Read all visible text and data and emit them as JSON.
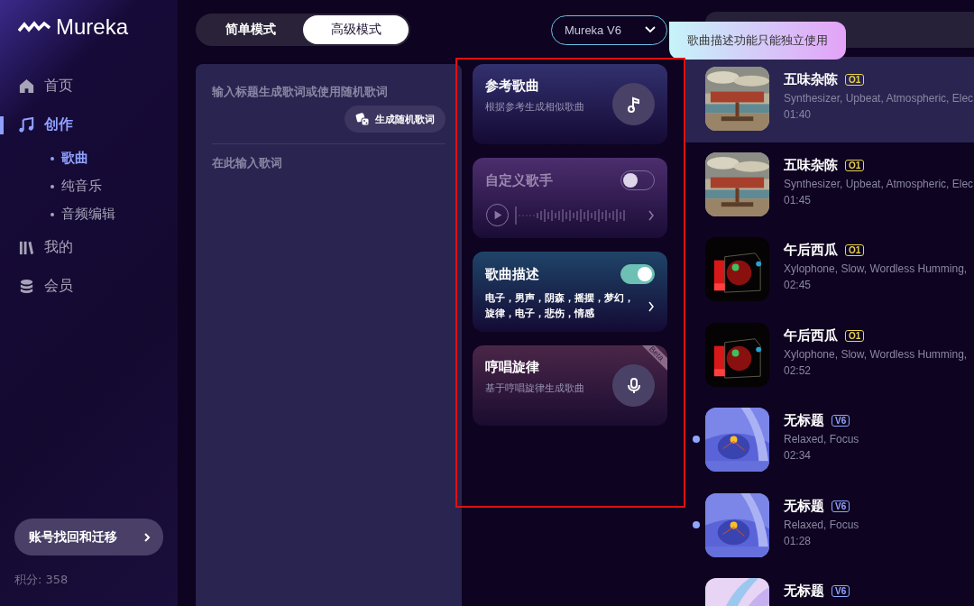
{
  "sidebar": {
    "logo": "Mureka",
    "nav": [
      {
        "kind": "home",
        "label": "首页",
        "selected": false
      },
      {
        "kind": "music",
        "label": "创作",
        "selected": true,
        "children": [
          {
            "label": "歌曲",
            "selected": true
          },
          {
            "label": "纯音乐",
            "selected": false
          },
          {
            "label": "音频编辑",
            "selected": false
          }
        ]
      },
      {
        "kind": "library",
        "label": "我的",
        "selected": false
      },
      {
        "kind": "coins",
        "label": "会员",
        "selected": false
      }
    ],
    "account_button": "账号找回和迁移",
    "points": "积分: 358"
  },
  "mode_tabs": [
    {
      "label": "简单模式",
      "selected": false
    },
    {
      "label": "高级模式",
      "selected": true
    }
  ],
  "model_select": "Mureka V6",
  "tooltip": "歌曲描述功能只能独立使用",
  "lyrics": {
    "title_placeholder": "输入标题生成歌词或使用随机歌词",
    "random_button": "生成随机歌词",
    "lyrics_placeholder": "在此输入歌词"
  },
  "cards": [
    {
      "kind": "reference",
      "title": "参考歌曲",
      "subtitle": "根据参考生成相似歌曲"
    },
    {
      "kind": "voice",
      "title": "自定义歌手",
      "on": false
    },
    {
      "kind": "description",
      "title": "歌曲描述",
      "on": true,
      "text": "电子，男声，阴森，摇摆，梦幻，旋律，电子，悲伤，情感"
    },
    {
      "kind": "humming",
      "title": "哼唱旋律",
      "subtitle": "基于哼唱旋律生成歌曲",
      "badge": "Beta"
    }
  ],
  "songs": [
    {
      "title": "五味杂陈",
      "badge": "O1",
      "color": "#e8d44a",
      "tags": "Synthesizer, Upbeat, Atmospheric, Elec",
      "duration": "01:40",
      "selected": true,
      "new": false
    },
    {
      "title": "五味杂陈",
      "badge": "O1",
      "color": "#e8d44a",
      "tags": "Synthesizer, Upbeat, Atmospheric, Elec",
      "duration": "01:45",
      "selected": false,
      "new": false
    },
    {
      "title": "午后西瓜",
      "badge": "O1",
      "color": "#e8d44a",
      "tags": "Xylophone, Slow, Wordless Humming,",
      "duration": "02:45",
      "selected": false,
      "new": false
    },
    {
      "title": "午后西瓜",
      "badge": "O1",
      "color": "#e8d44a",
      "tags": "Xylophone, Slow, Wordless Humming,",
      "duration": "02:52",
      "selected": false,
      "new": false
    },
    {
      "title": "无标题",
      "badge": "V6",
      "color": "#8fa6ff",
      "tags": "Relaxed, Focus",
      "duration": "02:34",
      "selected": false,
      "new": true
    },
    {
      "title": "无标题",
      "badge": "V6",
      "color": "#8fa6ff",
      "tags": "Relaxed, Focus",
      "duration": "01:28",
      "selected": false,
      "new": true
    },
    {
      "title": "无标题",
      "badge": "V6",
      "color": "#8fa6ff",
      "selected": false,
      "new": false
    }
  ]
}
